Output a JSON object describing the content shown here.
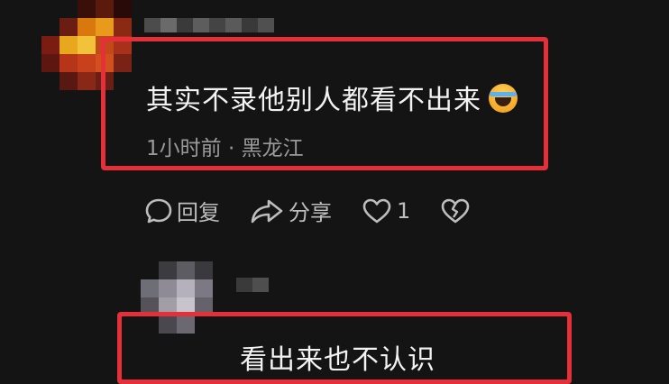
{
  "comment1": {
    "text": "其实不录他别人都看不出来",
    "emoji_icon": "laughing-crying-emoji-icon",
    "time": "1小时前",
    "separator": " · ",
    "location": "黑龙江"
  },
  "actions": {
    "reply_label": "回复",
    "share_label": "分享",
    "like_count": "1"
  },
  "comment2": {
    "text": "看出来也不认识"
  },
  "colors": {
    "background": "#141414",
    "highlight": "#e5303a",
    "meta": "#9a9a9a"
  }
}
